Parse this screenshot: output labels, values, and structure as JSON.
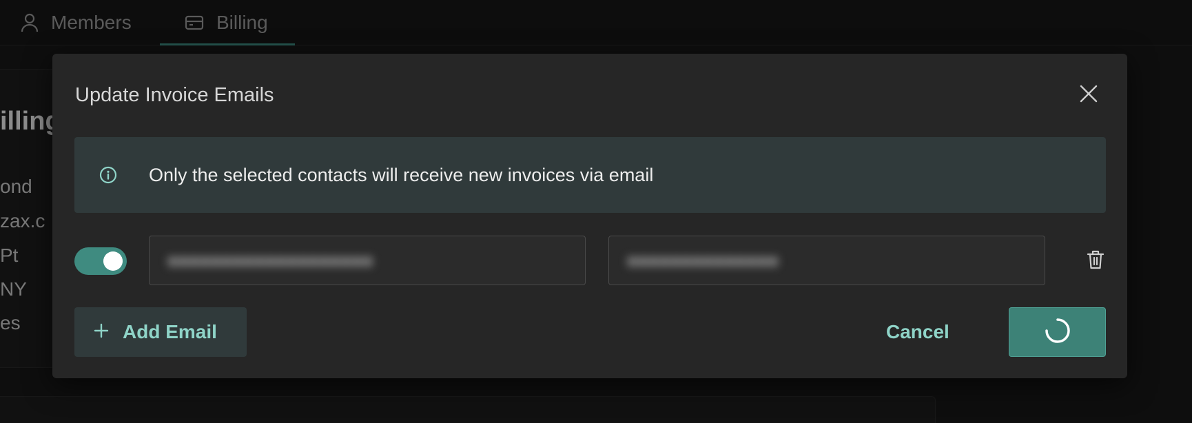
{
  "tabs": [
    {
      "label": "Members",
      "icon": "user-icon",
      "active": false
    },
    {
      "label": "Billing",
      "icon": "credit-card-icon",
      "active": true
    }
  ],
  "background": {
    "heading": "illing",
    "lines": [
      "ond",
      "zax.c",
      "Pt",
      "NY",
      "es"
    ]
  },
  "modal": {
    "title": "Update Invoice Emails",
    "info_text": "Only the selected contacts will receive new invoices via email",
    "contacts": [
      {
        "enabled": true
      }
    ],
    "add_email_label": "Add Email",
    "cancel_label": "Cancel",
    "save_state": "loading"
  },
  "colors": {
    "accent": "#3d8277",
    "accent_text": "#8fd4c8",
    "banner_bg": "#303a3b",
    "modal_bg": "#262626"
  }
}
